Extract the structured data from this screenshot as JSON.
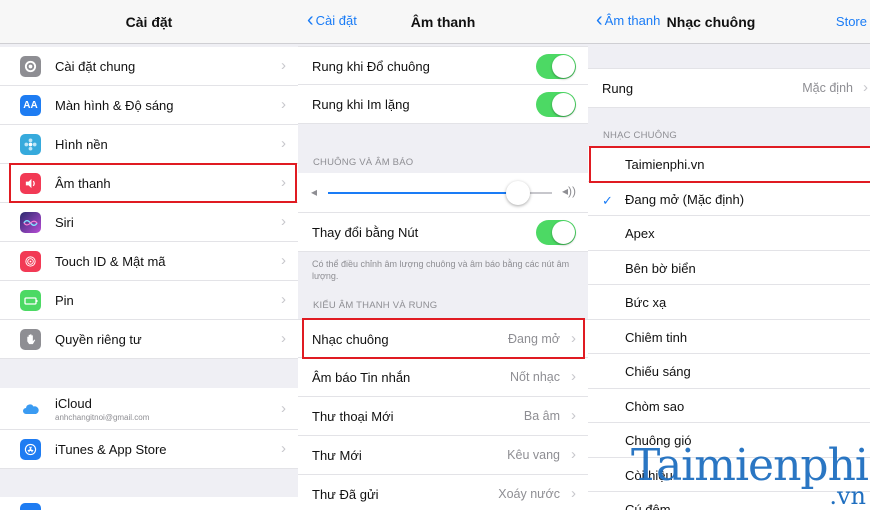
{
  "left_panel": {
    "title": "Cài đặt",
    "items": [
      {
        "label": "Cài đặt chung",
        "icon": "gear-icon",
        "color": "#8e8e93"
      },
      {
        "label": "Màn hình & Độ sáng",
        "icon": "display-icon",
        "icon_text": "AA",
        "color": "#1e7cf2"
      },
      {
        "label": "Hình nền",
        "icon": "wallpaper-icon",
        "color": "#36aadc"
      },
      {
        "label": "Âm thanh",
        "icon": "speaker-icon",
        "color": "#f23a55"
      },
      {
        "label": "Siri",
        "icon": "siri-icon",
        "color": "#3d3d8f"
      },
      {
        "label": "Touch ID & Mật mã",
        "icon": "fingerprint-icon",
        "color": "#f23a55"
      },
      {
        "label": "Pin",
        "icon": "battery-icon",
        "color": "#4cd964"
      },
      {
        "label": "Quyền riêng tư",
        "icon": "hand-icon",
        "color": "#8e8e93"
      },
      {
        "label": "iCloud",
        "sublabel": "anhchangitnoi@gmail.com",
        "icon": "cloud-icon",
        "color": "#ffffff"
      },
      {
        "label": "iTunes & App Store",
        "icon": "appstore-icon",
        "color": "#1e7cf2"
      }
    ]
  },
  "middle_panel": {
    "back_label": "Cài đặt",
    "title": "Âm thanh",
    "toggles": [
      {
        "label": "Rung khi Đổ chuông",
        "on": true
      },
      {
        "label": "Rung khi Im lặng",
        "on": true
      }
    ],
    "ringer_header": "CHUÔNG VÀ ÂM BÁO",
    "volume_level": 0.85,
    "change_with_buttons": {
      "label": "Thay đổi bằng Nút",
      "on": true
    },
    "note": "Có thể điều chỉnh âm lượng chuông và âm báo bằng các nút âm lượng.",
    "patterns_header": "KIỂU ÂM THANH VÀ RUNG",
    "items": [
      {
        "label": "Nhạc chuông",
        "value": "Đang mở"
      },
      {
        "label": "Âm báo Tin nhắn",
        "value": "Nốt nhạc"
      },
      {
        "label": "Thư thoại Mới",
        "value": "Ba âm"
      },
      {
        "label": "Thư Mới",
        "value": "Kêu vang"
      },
      {
        "label": "Thư Đã gửi",
        "value": "Xoáy nước"
      }
    ]
  },
  "right_panel": {
    "back_label": "Âm thanh",
    "title": "Nhạc chuông",
    "store_label": "Store",
    "vibration": {
      "label": "Rung",
      "value": "Mặc định"
    },
    "ringtones_header": "NHẠC CHUÔNG",
    "ringtones": [
      {
        "label": "Taimienphi.vn",
        "checked": false
      },
      {
        "label": "Đang mở (Mặc định)",
        "checked": true
      },
      {
        "label": "Apex",
        "checked": false
      },
      {
        "label": "Bên bờ biển",
        "checked": false
      },
      {
        "label": "Bức xạ",
        "checked": false
      },
      {
        "label": "Chiêm tinh",
        "checked": false
      },
      {
        "label": "Chiếu sáng",
        "checked": false
      },
      {
        "label": "Chòm sao",
        "checked": false
      },
      {
        "label": "Chuông gió",
        "checked": false
      },
      {
        "label": "Còi hiệu",
        "checked": false
      },
      {
        "label": "Cú đêm",
        "checked": false
      }
    ]
  },
  "watermark": {
    "text": "Taimienphi",
    "suffix": ".vn",
    "color": "#1f6fc0"
  },
  "highlight_color": "#e01b22",
  "accent_color": "#1a7cf6",
  "toggle_color": "#4cd964"
}
